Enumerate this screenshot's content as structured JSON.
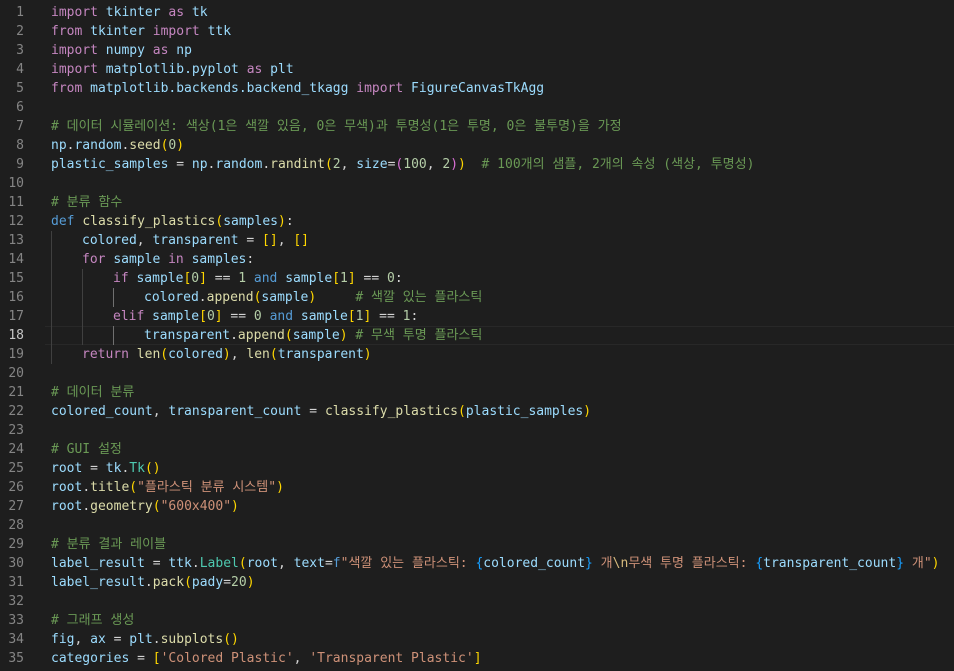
{
  "editor": {
    "active_line": 18,
    "lines": [
      {
        "n": "1",
        "indent": 0,
        "tokens": [
          [
            "kw",
            "import"
          ],
          [
            "op",
            " "
          ],
          [
            "var",
            "tkinter"
          ],
          [
            "op",
            " "
          ],
          [
            "kw",
            "as"
          ],
          [
            "op",
            " "
          ],
          [
            "var",
            "tk"
          ]
        ]
      },
      {
        "n": "2",
        "indent": 0,
        "tokens": [
          [
            "kw",
            "from"
          ],
          [
            "op",
            " "
          ],
          [
            "var",
            "tkinter"
          ],
          [
            "op",
            " "
          ],
          [
            "kw",
            "import"
          ],
          [
            "op",
            " "
          ],
          [
            "var",
            "ttk"
          ]
        ]
      },
      {
        "n": "3",
        "indent": 0,
        "tokens": [
          [
            "kw",
            "import"
          ],
          [
            "op",
            " "
          ],
          [
            "var",
            "numpy"
          ],
          [
            "op",
            " "
          ],
          [
            "kw",
            "as"
          ],
          [
            "op",
            " "
          ],
          [
            "var",
            "np"
          ]
        ]
      },
      {
        "n": "4",
        "indent": 0,
        "tokens": [
          [
            "kw",
            "import"
          ],
          [
            "op",
            " "
          ],
          [
            "var",
            "matplotlib.pyplot"
          ],
          [
            "op",
            " "
          ],
          [
            "kw",
            "as"
          ],
          [
            "op",
            " "
          ],
          [
            "var",
            "plt"
          ]
        ]
      },
      {
        "n": "5",
        "indent": 0,
        "tokens": [
          [
            "kw",
            "from"
          ],
          [
            "op",
            " "
          ],
          [
            "var",
            "matplotlib.backends.backend_tkagg"
          ],
          [
            "op",
            " "
          ],
          [
            "kw",
            "import"
          ],
          [
            "op",
            " "
          ],
          [
            "var",
            "FigureCanvasTkAgg"
          ]
        ]
      },
      {
        "n": "6",
        "indent": 0,
        "tokens": []
      },
      {
        "n": "7",
        "indent": 0,
        "tokens": [
          [
            "cmt",
            "# 데이터 시뮬레이션: 색상(1은 색깔 있음, 0은 무색)과 투명성(1은 투명, 0은 불투명)을 가정"
          ]
        ]
      },
      {
        "n": "8",
        "indent": 0,
        "tokens": [
          [
            "var",
            "np"
          ],
          [
            "op",
            "."
          ],
          [
            "var",
            "random"
          ],
          [
            "op",
            "."
          ],
          [
            "fn",
            "seed"
          ],
          [
            "p1",
            "("
          ],
          [
            "num",
            "0"
          ],
          [
            "p1",
            ")"
          ]
        ]
      },
      {
        "n": "9",
        "indent": 0,
        "tokens": [
          [
            "var",
            "plastic_samples"
          ],
          [
            "op",
            " = "
          ],
          [
            "var",
            "np"
          ],
          [
            "op",
            "."
          ],
          [
            "var",
            "random"
          ],
          [
            "op",
            "."
          ],
          [
            "fn",
            "randint"
          ],
          [
            "p1",
            "("
          ],
          [
            "num",
            "2"
          ],
          [
            "op",
            ", "
          ],
          [
            "var",
            "size"
          ],
          [
            "op",
            "="
          ],
          [
            "p2",
            "("
          ],
          [
            "num",
            "100"
          ],
          [
            "op",
            ", "
          ],
          [
            "num",
            "2"
          ],
          [
            "p2",
            ")"
          ],
          [
            "p1",
            ")"
          ],
          [
            "op",
            "  "
          ],
          [
            "cmt",
            "# 100개의 샘플, 2개의 속성 (색상, 투명성)"
          ]
        ]
      },
      {
        "n": "10",
        "indent": 0,
        "tokens": []
      },
      {
        "n": "11",
        "indent": 0,
        "tokens": [
          [
            "cmt",
            "# 분류 함수"
          ]
        ]
      },
      {
        "n": "12",
        "indent": 0,
        "tokens": [
          [
            "def",
            "def"
          ],
          [
            "op",
            " "
          ],
          [
            "fn",
            "classify_plastics"
          ],
          [
            "p1",
            "("
          ],
          [
            "var",
            "samples"
          ],
          [
            "p1",
            ")"
          ],
          [
            "op",
            ":"
          ]
        ]
      },
      {
        "n": "13",
        "indent": 1,
        "tokens": [
          [
            "var",
            "colored"
          ],
          [
            "op",
            ", "
          ],
          [
            "var",
            "transparent"
          ],
          [
            "op",
            " = "
          ],
          [
            "p1",
            "[]"
          ],
          [
            "op",
            ", "
          ],
          [
            "p1",
            "[]"
          ]
        ]
      },
      {
        "n": "14",
        "indent": 1,
        "tokens": [
          [
            "kw",
            "for"
          ],
          [
            "op",
            " "
          ],
          [
            "var",
            "sample"
          ],
          [
            "op",
            " "
          ],
          [
            "kw",
            "in"
          ],
          [
            "op",
            " "
          ],
          [
            "var",
            "samples"
          ],
          [
            "op",
            ":"
          ]
        ]
      },
      {
        "n": "15",
        "indent": 2,
        "tokens": [
          [
            "kw",
            "if"
          ],
          [
            "op",
            " "
          ],
          [
            "var",
            "sample"
          ],
          [
            "p1",
            "["
          ],
          [
            "num",
            "0"
          ],
          [
            "p1",
            "]"
          ],
          [
            "op",
            " == "
          ],
          [
            "num",
            "1"
          ],
          [
            "op",
            " "
          ],
          [
            "def",
            "and"
          ],
          [
            "op",
            " "
          ],
          [
            "var",
            "sample"
          ],
          [
            "p1",
            "["
          ],
          [
            "num",
            "1"
          ],
          [
            "p1",
            "]"
          ],
          [
            "op",
            " == "
          ],
          [
            "num",
            "0"
          ],
          [
            "op",
            ":"
          ]
        ]
      },
      {
        "n": "16",
        "indent": 3,
        "tokens": [
          [
            "var",
            "colored"
          ],
          [
            "op",
            "."
          ],
          [
            "fn",
            "append"
          ],
          [
            "p1",
            "("
          ],
          [
            "var",
            "sample"
          ],
          [
            "p1",
            ")"
          ],
          [
            "op",
            "     "
          ],
          [
            "cmt",
            "# 색깔 있는 플라스틱"
          ]
        ]
      },
      {
        "n": "17",
        "indent": 2,
        "tokens": [
          [
            "kw",
            "elif"
          ],
          [
            "op",
            " "
          ],
          [
            "var",
            "sample"
          ],
          [
            "p1",
            "["
          ],
          [
            "num",
            "0"
          ],
          [
            "p1",
            "]"
          ],
          [
            "op",
            " == "
          ],
          [
            "num",
            "0"
          ],
          [
            "op",
            " "
          ],
          [
            "def",
            "and"
          ],
          [
            "op",
            " "
          ],
          [
            "var",
            "sample"
          ],
          [
            "p1",
            "["
          ],
          [
            "num",
            "1"
          ],
          [
            "p1",
            "]"
          ],
          [
            "op",
            " == "
          ],
          [
            "num",
            "1"
          ],
          [
            "op",
            ":"
          ]
        ]
      },
      {
        "n": "18",
        "indent": 3,
        "tokens": [
          [
            "var",
            "transparent"
          ],
          [
            "op",
            "."
          ],
          [
            "fn",
            "append"
          ],
          [
            "p1",
            "("
          ],
          [
            "var",
            "sample"
          ],
          [
            "p1",
            ")"
          ],
          [
            "op",
            " "
          ],
          [
            "cmt",
            "# 무색 투명 플라스틱"
          ]
        ]
      },
      {
        "n": "19",
        "indent": 1,
        "tokens": [
          [
            "kw",
            "return"
          ],
          [
            "op",
            " "
          ],
          [
            "fn",
            "len"
          ],
          [
            "p1",
            "("
          ],
          [
            "var",
            "colored"
          ],
          [
            "p1",
            ")"
          ],
          [
            "op",
            ", "
          ],
          [
            "fn",
            "len"
          ],
          [
            "p1",
            "("
          ],
          [
            "var",
            "transparent"
          ],
          [
            "p1",
            ")"
          ]
        ]
      },
      {
        "n": "20",
        "indent": 0,
        "tokens": []
      },
      {
        "n": "21",
        "indent": 0,
        "tokens": [
          [
            "cmt",
            "# 데이터 분류"
          ]
        ]
      },
      {
        "n": "22",
        "indent": 0,
        "tokens": [
          [
            "var",
            "colored_count"
          ],
          [
            "op",
            ", "
          ],
          [
            "var",
            "transparent_count"
          ],
          [
            "op",
            " = "
          ],
          [
            "fn",
            "classify_plastics"
          ],
          [
            "p1",
            "("
          ],
          [
            "var",
            "plastic_samples"
          ],
          [
            "p1",
            ")"
          ]
        ]
      },
      {
        "n": "23",
        "indent": 0,
        "tokens": []
      },
      {
        "n": "24",
        "indent": 0,
        "tokens": [
          [
            "cmt",
            "# GUI 설정"
          ]
        ]
      },
      {
        "n": "25",
        "indent": 0,
        "tokens": [
          [
            "var",
            "root"
          ],
          [
            "op",
            " = "
          ],
          [
            "var",
            "tk"
          ],
          [
            "op",
            "."
          ],
          [
            "cls",
            "Tk"
          ],
          [
            "p1",
            "()"
          ]
        ]
      },
      {
        "n": "26",
        "indent": 0,
        "tokens": [
          [
            "var",
            "root"
          ],
          [
            "op",
            "."
          ],
          [
            "fn",
            "title"
          ],
          [
            "p1",
            "("
          ],
          [
            "str",
            "\"플라스틱 분류 시스템\""
          ],
          [
            "p1",
            ")"
          ]
        ]
      },
      {
        "n": "27",
        "indent": 0,
        "tokens": [
          [
            "var",
            "root"
          ],
          [
            "op",
            "."
          ],
          [
            "fn",
            "geometry"
          ],
          [
            "p1",
            "("
          ],
          [
            "str",
            "\"600x400\""
          ],
          [
            "p1",
            ")"
          ]
        ]
      },
      {
        "n": "28",
        "indent": 0,
        "tokens": []
      },
      {
        "n": "29",
        "indent": 0,
        "tokens": [
          [
            "cmt",
            "# 분류 결과 레이블"
          ]
        ]
      },
      {
        "n": "30",
        "indent": 0,
        "tokens": [
          [
            "var",
            "label_result"
          ],
          [
            "op",
            " = "
          ],
          [
            "var",
            "ttk"
          ],
          [
            "op",
            "."
          ],
          [
            "cls",
            "Label"
          ],
          [
            "p1",
            "("
          ],
          [
            "var",
            "root"
          ],
          [
            "op",
            ", "
          ],
          [
            "var",
            "text"
          ],
          [
            "op",
            "="
          ],
          [
            "def",
            "f"
          ],
          [
            "str",
            "\"색깔 있는 플라스틱: "
          ],
          [
            "p3",
            "{"
          ],
          [
            "var",
            "colored_count"
          ],
          [
            "p3",
            "}"
          ],
          [
            "str",
            " 개"
          ],
          [
            "esc",
            "\\n"
          ],
          [
            "str",
            "무색 투명 플라스틱: "
          ],
          [
            "p3",
            "{"
          ],
          [
            "var",
            "transparent_count"
          ],
          [
            "p3",
            "}"
          ],
          [
            "str",
            " 개\""
          ],
          [
            "p1",
            ")"
          ]
        ]
      },
      {
        "n": "31",
        "indent": 0,
        "tokens": [
          [
            "var",
            "label_result"
          ],
          [
            "op",
            "."
          ],
          [
            "fn",
            "pack"
          ],
          [
            "p1",
            "("
          ],
          [
            "var",
            "pady"
          ],
          [
            "op",
            "="
          ],
          [
            "num",
            "20"
          ],
          [
            "p1",
            ")"
          ]
        ]
      },
      {
        "n": "32",
        "indent": 0,
        "tokens": []
      },
      {
        "n": "33",
        "indent": 0,
        "tokens": [
          [
            "cmt",
            "# 그래프 생성"
          ]
        ]
      },
      {
        "n": "34",
        "indent": 0,
        "tokens": [
          [
            "var",
            "fig"
          ],
          [
            "op",
            ", "
          ],
          [
            "var",
            "ax"
          ],
          [
            "op",
            " = "
          ],
          [
            "var",
            "plt"
          ],
          [
            "op",
            "."
          ],
          [
            "fn",
            "subplots"
          ],
          [
            "p1",
            "()"
          ]
        ]
      },
      {
        "n": "35",
        "indent": 0,
        "tokens": [
          [
            "var",
            "categories"
          ],
          [
            "op",
            " = "
          ],
          [
            "p1",
            "["
          ],
          [
            "str",
            "'Colored Plastic'"
          ],
          [
            "op",
            ", "
          ],
          [
            "str",
            "'Transparent Plastic'"
          ],
          [
            "p1",
            "]"
          ]
        ]
      }
    ]
  }
}
